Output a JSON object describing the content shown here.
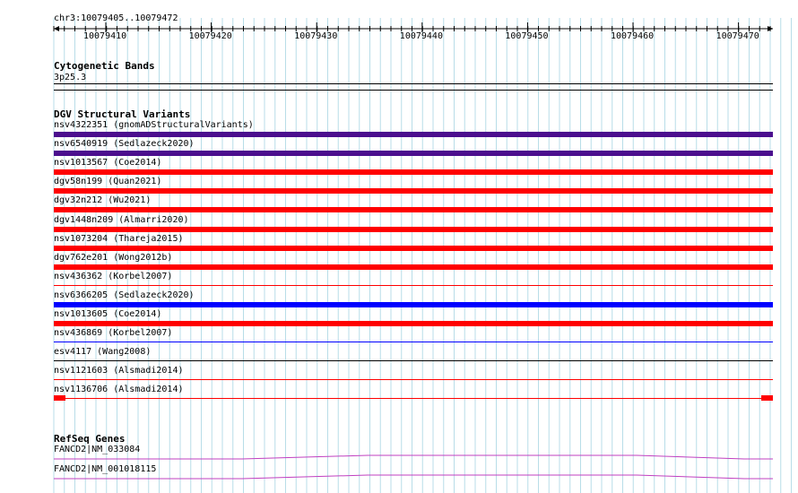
{
  "ruler": {
    "location": "chr3:10079405..10079472",
    "ticks": [
      "10079410",
      "10079420",
      "10079430",
      "10079440",
      "10079450",
      "10079460",
      "10079470"
    ]
  },
  "cytoband": {
    "title": "Cytogenetic Bands",
    "band": "3p25.3"
  },
  "dgv": {
    "title": "DGV Structural Variants",
    "tracks": [
      {
        "label": "nsv4322351 (gnomADStructuralVariants)",
        "color": "#4b0e8e",
        "thick": true
      },
      {
        "label": "nsv6540919 (Sedlazeck2020)",
        "color": "#4b0e8e",
        "thick": true
      },
      {
        "label": "nsv1013567 (Coe2014)",
        "color": "#ff0000",
        "thick": true
      },
      {
        "label": "dgv58n199 (Quan2021)",
        "color": "#ff0000",
        "thick": true
      },
      {
        "label": "dgv32n212 (Wu2021)",
        "color": "#ff0000",
        "thick": true
      },
      {
        "label": "dgv1448n209 (Almarri2020)",
        "color": "#ff0000",
        "thick": true
      },
      {
        "label": "nsv1073204 (Thareja2015)",
        "color": "#ff0000",
        "thick": true
      },
      {
        "label": "dgv762e201 (Wong2012b)",
        "color": "#ff0000",
        "thick": true
      },
      {
        "label": "nsv436362 (Korbel2007)",
        "color": "#ff0000",
        "thick": false
      },
      {
        "label": "nsv6366205 (Sedlazeck2020)",
        "color": "#0000ff",
        "thick": true
      },
      {
        "label": "nsv1013605 (Coe2014)",
        "color": "#ff0000",
        "thick": true
      },
      {
        "label": "nsv436869 (Korbel2007)",
        "color": "#0000ff",
        "thick": false
      },
      {
        "label": "esv4117 (Wang2008)",
        "color": "#000000",
        "thick": false
      },
      {
        "label": "nsv1121603 (Alsmadi2014)",
        "color": "#ff0000",
        "thick": false
      },
      {
        "label": "nsv1136706 (Alsmadi2014)",
        "color": "#ff0000",
        "thick": false
      }
    ]
  },
  "refseq": {
    "title": "RefSeq Genes",
    "genes": [
      {
        "label": "FANCD2|NM_033084",
        "color": "#c040c0"
      },
      {
        "label": "FANCD2|NM_001018115",
        "color": "#c040c0"
      }
    ]
  }
}
